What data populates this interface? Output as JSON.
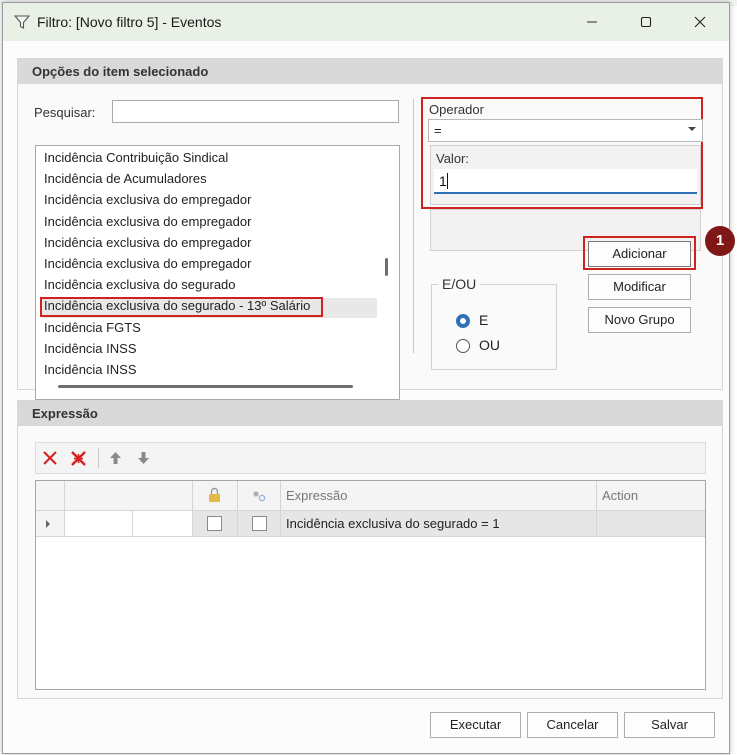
{
  "window": {
    "title": "Filtro: [Novo filtro 5] - Eventos"
  },
  "options_panel": {
    "header": "Opções do item selecionado",
    "search_label": "Pesquisar:",
    "search_value": "",
    "items": [
      "Incidência Contribuição Sindical",
      "Incidência de Acumuladores",
      "Incidência exclusiva do empregador",
      "Incidência exclusiva do empregador",
      "Incidência exclusiva do empregador",
      "Incidência exclusiva do empregador",
      "Incidência exclusiva do segurado",
      "Incidência exclusiva do segurado - 13º Salário",
      "Incidência FGTS",
      "Incidência INSS",
      "Incidência INSS"
    ],
    "selected_index": 7
  },
  "operator": {
    "label": "Operador",
    "value": "="
  },
  "valor": {
    "label": "Valor:",
    "value": "1"
  },
  "e_ou": {
    "legend": "E/OU",
    "option_e": "E",
    "option_ou": "OU",
    "selected": "E"
  },
  "buttons": {
    "adicionar": "Adicionar",
    "modificar": "Modificar",
    "novo_grupo": "Novo Grupo",
    "executar": "Executar",
    "cancelar": "Cancelar",
    "salvar": "Salvar"
  },
  "badge": "1",
  "expression_panel": {
    "header": "Expressão",
    "columns": {
      "expressao": "Expressão",
      "action": "Action"
    },
    "rows": [
      {
        "expressao": "Incidência exclusiva do segurado = 1",
        "action": ""
      }
    ]
  },
  "colors": {
    "highlight_red": "#d02020",
    "accent_blue": "#2f6fb6",
    "badge_bg": "#7f1717"
  }
}
